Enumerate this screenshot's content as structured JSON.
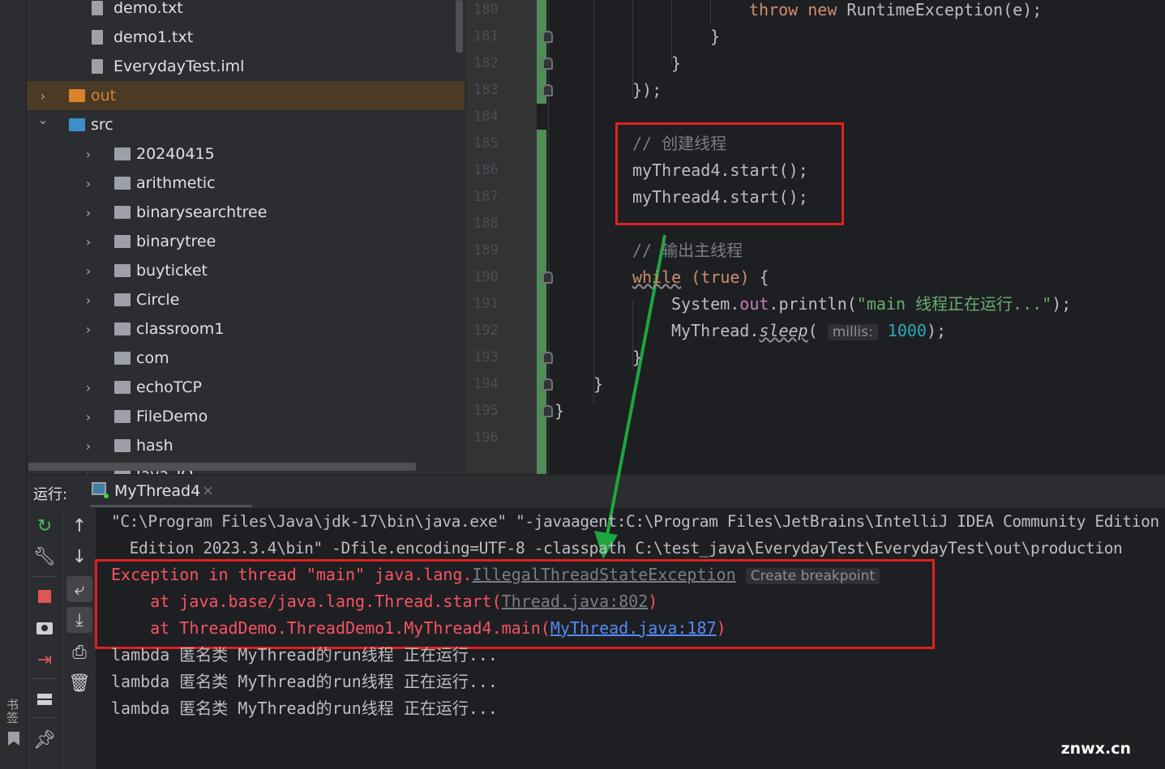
{
  "colors": {
    "keyword": "#cf8e6d",
    "comment": "#7a7e85",
    "string": "#6aab73",
    "number": "#2aacb8",
    "error": "#f75464",
    "link": "#548af7",
    "static": "#c77dbb",
    "redbox": "#e02020",
    "arrow": "#1fa53f",
    "green_status": "#4f8d57"
  },
  "sidebar": {
    "bookmarks_label": "书签"
  },
  "tree": {
    "items": [
      {
        "label": "demo.txt",
        "icon": "text-file-icon",
        "indent": 0,
        "chev": ""
      },
      {
        "label": "demo1.txt",
        "icon": "text-file-icon",
        "indent": 0,
        "chev": ""
      },
      {
        "label": "EverydayTest.iml",
        "icon": "module-file-icon",
        "indent": 0,
        "chev": ""
      },
      {
        "label": "out",
        "icon": "orange-folder-icon",
        "indent": -1,
        "chev": "right",
        "selected": true
      },
      {
        "label": "src",
        "icon": "source-folder-icon",
        "indent": -1,
        "chev": "down"
      },
      {
        "label": "20240415",
        "icon": "package-icon",
        "indent": 1,
        "chev": "right"
      },
      {
        "label": "arithmetic",
        "icon": "package-icon",
        "indent": 1,
        "chev": "right"
      },
      {
        "label": "binarysearchtree",
        "icon": "package-icon",
        "indent": 1,
        "chev": "right"
      },
      {
        "label": "binarytree",
        "icon": "package-icon",
        "indent": 1,
        "chev": "right"
      },
      {
        "label": "buyticket",
        "icon": "package-icon",
        "indent": 1,
        "chev": "right"
      },
      {
        "label": "Circle",
        "icon": "package-icon",
        "indent": 1,
        "chev": "right"
      },
      {
        "label": "classroom1",
        "icon": "package-icon",
        "indent": 1,
        "chev": "right"
      },
      {
        "label": "com",
        "icon": "package-icon",
        "indent": 1,
        "chev": ""
      },
      {
        "label": "echoTCP",
        "icon": "package-icon",
        "indent": 1,
        "chev": "right"
      },
      {
        "label": "FileDemo",
        "icon": "package-icon",
        "indent": 1,
        "chev": "right"
      },
      {
        "label": "hash",
        "icon": "package-icon",
        "indent": 1,
        "chev": "right"
      },
      {
        "label": "Java_IO",
        "icon": "package-icon",
        "indent": 1,
        "chev": "right"
      }
    ]
  },
  "editor": {
    "line_numbers": [
      "180",
      "181",
      "182",
      "183",
      "184",
      "185",
      "186",
      "187",
      "188",
      "189",
      "190",
      "191",
      "192",
      "193",
      "194",
      "195",
      "196"
    ],
    "lines": [
      {
        "indent": 5,
        "segs": [
          {
            "t": "throw new ",
            "c": "keyword"
          },
          {
            "t": "RuntimeException(e);"
          }
        ]
      },
      {
        "indent": 4,
        "segs": [
          {
            "t": "}"
          }
        ]
      },
      {
        "indent": 3,
        "segs": [
          {
            "t": "}"
          }
        ]
      },
      {
        "indent": 2,
        "segs": [
          {
            "t": "});"
          }
        ]
      },
      {
        "indent": 2,
        "segs": []
      },
      {
        "indent": 2,
        "segs": [
          {
            "t": "// 创建线程",
            "c": "comment"
          }
        ]
      },
      {
        "indent": 2,
        "segs": [
          {
            "t": "myThread4.start();"
          }
        ]
      },
      {
        "indent": 2,
        "segs": [
          {
            "t": "myThread4.start();"
          }
        ]
      },
      {
        "indent": 2,
        "segs": []
      },
      {
        "indent": 2,
        "segs": [
          {
            "t": "// 输出主线程",
            "c": "comment"
          }
        ]
      },
      {
        "indent": 2,
        "segs": [
          {
            "t": "while",
            "c": "keyword",
            "u": true
          },
          {
            "t": " "
          },
          {
            "t": "(true)",
            "c": "keyword"
          },
          {
            "t": " {"
          }
        ]
      },
      {
        "indent": 3,
        "segs": [
          {
            "t": "System."
          },
          {
            "t": "out",
            "c": "static"
          },
          {
            "t": ".println("
          },
          {
            "t": "\"main 线程正在运行...\"",
            "c": "string"
          },
          {
            "t": ");"
          }
        ]
      },
      {
        "indent": 3,
        "segs": [
          {
            "t": "MyThread."
          },
          {
            "t": "sleep",
            "i": true,
            "u": true
          },
          {
            "t": "( "
          },
          {
            "t": "millis:",
            "hint": true
          },
          {
            "t": " "
          },
          {
            "t": "1000",
            "c": "number"
          },
          {
            "t": ");"
          }
        ]
      },
      {
        "indent": 2,
        "segs": [
          {
            "t": "}"
          }
        ]
      },
      {
        "indent": 1,
        "segs": [
          {
            "t": "}"
          }
        ]
      },
      {
        "indent": 0,
        "segs": [
          {
            "t": "}"
          }
        ]
      },
      {
        "indent": 0,
        "segs": []
      }
    ]
  },
  "run": {
    "label": "运行:",
    "tab": "MyThread4",
    "close": "×"
  },
  "console": {
    "lines": [
      {
        "segs": [
          {
            "t": "\"C:\\Program Files\\Java\\jdk-17\\bin\\java.exe\" \"-javaagent:C:\\Program Files\\JetBrains\\IntelliJ IDEA Community Edition"
          }
        ]
      },
      {
        "segs": [
          {
            "t": "  Edition 2023.3.4\\bin\" -Dfile.encoding=UTF-8 -classpath C:\\test_java\\EverydayTest\\EverydayTest\\out\\production"
          }
        ]
      },
      {
        "segs": [
          {
            "t": "Exception in thread \"main\" java.lang.",
            "c": "error"
          },
          {
            "t": "IllegalThreadStateException",
            "c": "comment",
            "u": true
          },
          {
            "t": " "
          },
          {
            "t": "Create breakpoint",
            "hint": true
          }
        ]
      },
      {
        "segs": [
          {
            "t": "    at java.base/java.lang.Thread.start(",
            "c": "error"
          },
          {
            "t": "Thread.java:802",
            "c": "comment",
            "u": true
          },
          {
            "t": ")",
            "c": "error"
          }
        ]
      },
      {
        "segs": [
          {
            "t": "    at ThreadDemo.ThreadDemo1.MyThread4.main(",
            "c": "error"
          },
          {
            "t": "MyThread.java:187",
            "c": "link",
            "u": true
          },
          {
            "t": ")",
            "c": "error"
          }
        ]
      },
      {
        "segs": [
          {
            "t": "lambda 匿名类 MyThread的run线程 正在运行..."
          }
        ]
      },
      {
        "segs": [
          {
            "t": "lambda 匿名类 MyThread的run线程 正在运行..."
          }
        ]
      },
      {
        "segs": [
          {
            "t": "lambda 匿名类 MyThread的run线程 正在运行..."
          }
        ]
      }
    ]
  },
  "watermark": "znwx.cn"
}
